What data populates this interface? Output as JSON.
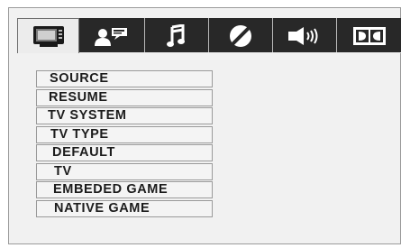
{
  "tabs": [
    {
      "id": "setup",
      "icon": "tv-setup-icon",
      "active": true
    },
    {
      "id": "language",
      "icon": "person-speech-icon",
      "active": false
    },
    {
      "id": "audio",
      "icon": "music-note-icon",
      "active": false
    },
    {
      "id": "video",
      "icon": "slash-circle-icon",
      "active": false
    },
    {
      "id": "speaker",
      "icon": "speaker-icon",
      "active": false
    },
    {
      "id": "dolby",
      "icon": "dolby-icon",
      "active": false
    }
  ],
  "menu": {
    "items": [
      {
        "label": "SOURCE"
      },
      {
        "label": "RESUME"
      },
      {
        "label": "TV SYSTEM"
      },
      {
        "label": "TV TYPE"
      },
      {
        "label": "DEFAULT"
      },
      {
        "label": "TV"
      },
      {
        "label": "EMBEDED GAME"
      },
      {
        "label": "NATIVE GAME"
      }
    ]
  },
  "colors": {
    "tab_dark": "#282828",
    "tab_active": "#ececec",
    "panel": "#f1f1f1",
    "item_border": "#9a9a9a"
  }
}
